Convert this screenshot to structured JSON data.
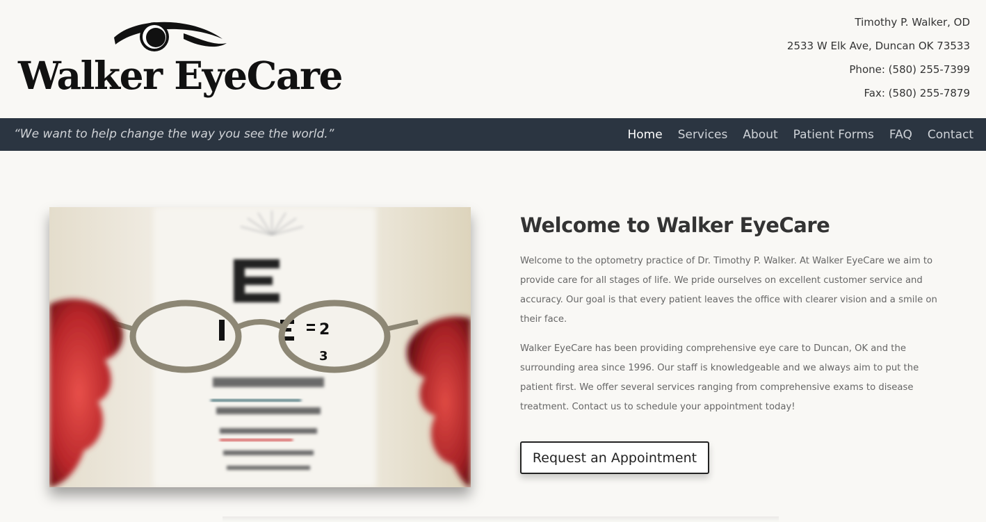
{
  "brand": {
    "logo_text": "Walker EyeCare"
  },
  "contact": {
    "doctor": "Timothy P. Walker, OD",
    "address": "2533 W Elk Ave, Duncan OK 73533",
    "phone": "Phone: (580) 255-7399",
    "fax": "Fax: (580) 255-7879"
  },
  "navbar": {
    "tagline": "“We want to help change the way you see the world.”",
    "items": [
      {
        "label": "Home",
        "active": true
      },
      {
        "label": "Services",
        "active": false
      },
      {
        "label": "About",
        "active": false
      },
      {
        "label": "Patient Forms",
        "active": false
      },
      {
        "label": "FAQ",
        "active": false
      },
      {
        "label": "Contact",
        "active": false
      }
    ]
  },
  "main": {
    "heading": "Welcome to Walker EyeCare",
    "paragraph1": "Welcome to the optometry practice of Dr. Timothy P. Walker. At Walker EyeCare we aim to provide care for all stages of life. We pride ourselves on excellent customer service and accuracy. Our goal is that every patient leaves the office with clearer vision and a smile on their face.",
    "paragraph2": "Walker EyeCare has been providing comprehensive eye care to Duncan, OK and the surrounding area since 1996. Our staff is knowledgeable and we always aim to put the patient first. We offer several services ranging from comprehensive exams to disease treatment. Contact us to schedule your appointment today!",
    "cta_label": "Request an Appointment"
  },
  "colors": {
    "nav_bg": "#2b3541",
    "page_bg": "#f9f8f5"
  }
}
